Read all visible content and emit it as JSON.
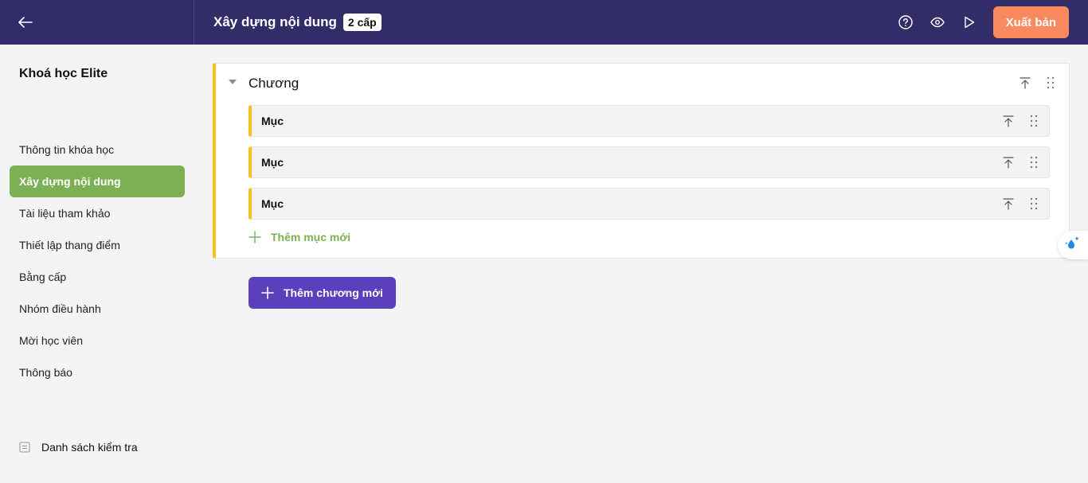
{
  "header": {
    "title": "Xây dựng nội dung",
    "level_badge": "2 cấp",
    "publish_label": "Xuất bản",
    "icons": [
      "back-arrow-icon",
      "help-icon",
      "eye-icon",
      "play-icon"
    ]
  },
  "sidebar": {
    "course_title": "Khoá học Elite",
    "items": [
      {
        "label": "Thông tin khóa học",
        "active": false
      },
      {
        "label": "Xây dựng nội dung",
        "active": true
      },
      {
        "label": "Tài liệu tham khảo",
        "active": false
      },
      {
        "label": "Thiết lập thang điểm",
        "active": false
      },
      {
        "label": "Bằng cấp",
        "active": false
      },
      {
        "label": "Nhóm điều hành",
        "active": false
      },
      {
        "label": "Mời học viên",
        "active": false
      },
      {
        "label": "Thông báo",
        "active": false
      }
    ],
    "checklist_label": "Danh sách kiểm tra"
  },
  "content": {
    "chapter": {
      "label": "Chương",
      "sections": [
        {
          "label": "Mục"
        },
        {
          "label": "Mục"
        },
        {
          "label": "Mục"
        }
      ],
      "add_section_label": "Thêm mục mới"
    },
    "add_chapter_label": "Thêm chương mới"
  },
  "colors": {
    "header_bg": "#322d69",
    "active_nav": "#7db054",
    "accent_yellow": "#f8c21c",
    "publish_btn": "#f98a5d",
    "add_chapter_btn": "#5b3fbd"
  }
}
